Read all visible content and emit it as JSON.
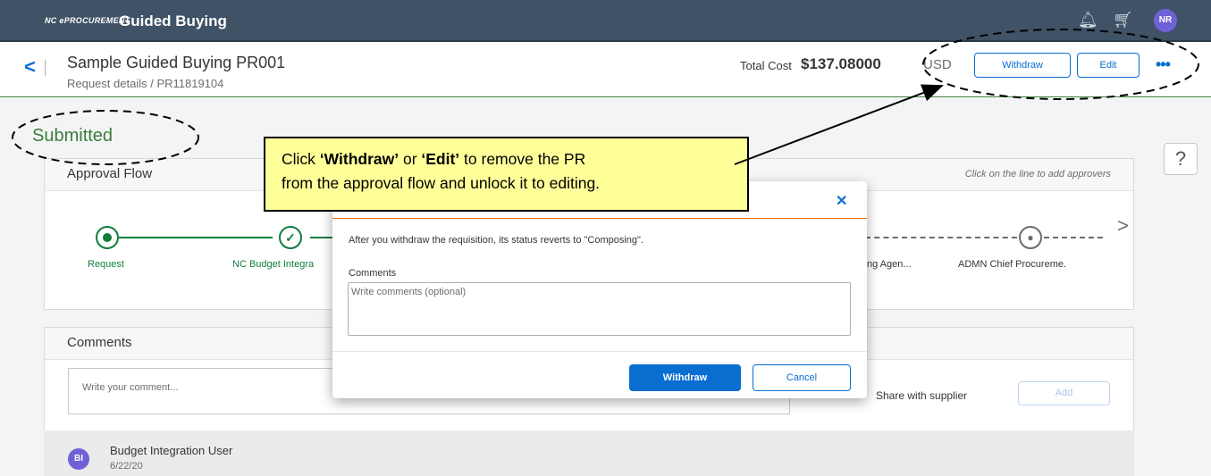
{
  "topbar": {
    "brand_small": "NC ePROCUREMENT",
    "brand_title": "Guided Buying",
    "avatar_initials": "NR"
  },
  "header": {
    "back_icon": "chevron-left-icon",
    "title": "Sample Guided Buying PR001",
    "breadcrumb": "Request details  /  PR11819104",
    "total_label": "Total Cost",
    "total_value": "$137.08000",
    "currency": "USD",
    "withdraw_label": "Withdraw",
    "edit_label": "Edit",
    "more_icon": "more-icon"
  },
  "status": "Submitted",
  "approval_flow": {
    "title": "Approval Flow",
    "hint": "Click on the line to add approvers",
    "steps": [
      "Request",
      "NC Budget Integra",
      "ng Agen...",
      "ADMN Chief Procureme."
    ]
  },
  "comments_panel": {
    "title": "Comments",
    "placeholder": "Write your comment...",
    "share_label": "Share with supplier",
    "add_label": "Add",
    "entries": [
      {
        "initials": "BI",
        "author": "Budget Integration User",
        "date": "6/22/20"
      }
    ]
  },
  "dialog": {
    "close_icon": "close-icon",
    "message": "After you withdraw the requisition, its status reverts to \"Composing\".",
    "comments_label": "Comments",
    "comments_placeholder": "Write comments (optional)",
    "withdraw_label": "Withdraw",
    "cancel_label": "Cancel"
  },
  "callout": {
    "prefix": "Click ",
    "withdraw": "‘Withdraw’",
    "or": " or ",
    "edit": "‘Edit’",
    "line1_end": " to remove the PR",
    "line2": "from the approval flow and unlock it to editing."
  },
  "colors": {
    "topbar": "#3f5266",
    "accent": "#0a6ed1",
    "status_green": "#107e3e",
    "callout_bg": "#ffff99"
  }
}
